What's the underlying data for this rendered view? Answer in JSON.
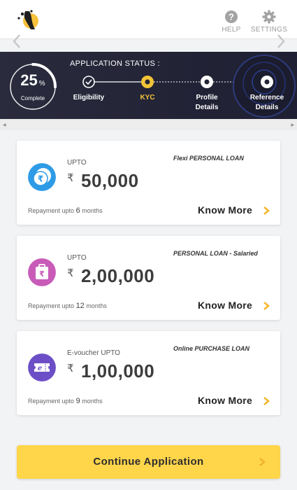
{
  "header": {
    "help_label": "HELP",
    "settings_label": "SETTINGS"
  },
  "status": {
    "title": "APPLICATION STATUS :",
    "percent": "25",
    "percent_symbol": "%",
    "percent_label": "Complete",
    "progress_fraction": 0.25,
    "steps": [
      {
        "label": "Eligibility",
        "state": "done"
      },
      {
        "label": "KYC",
        "state": "current"
      },
      {
        "label": "Profile",
        "label2": "Details",
        "state": "pending"
      },
      {
        "label": "Reference",
        "label2": "Details",
        "state": "pending"
      }
    ]
  },
  "cards": [
    {
      "icon": "rupee-coin-icon",
      "prefix": "UPTO",
      "currency": "₹",
      "amount": "50,000",
      "loan_type": "Flexi PERSONAL LOAN",
      "repay_prefix": "Repayment upto",
      "repay_num": "6",
      "repay_unit": "months",
      "cta": "Know More"
    },
    {
      "icon": "rupee-bag-icon",
      "prefix": "UPTO",
      "currency": "₹",
      "amount": "2,00,000",
      "loan_type": "PERSONAL LOAN - Salaried",
      "repay_prefix": "Repayment upto",
      "repay_num": "12",
      "repay_unit": "months",
      "cta": "Know More"
    },
    {
      "icon": "voucher-ticket-icon",
      "prefix": "E-voucher UPTO",
      "currency": "₹",
      "amount": "1,00,000",
      "loan_type": "Online PURCHASE LOAN",
      "repay_prefix": "Repayment upto",
      "repay_num": "9",
      "repay_unit": "months",
      "cta": "Know More"
    }
  ],
  "continue_label": "Continue Application",
  "colors": {
    "accent": "#ffd54a",
    "banner": "#25263a",
    "card_arrow": "#f5b82e",
    "icon_blue": "#2e9be6",
    "icon_pink": "#c85bb8",
    "icon_purple": "#6c4fc7"
  }
}
